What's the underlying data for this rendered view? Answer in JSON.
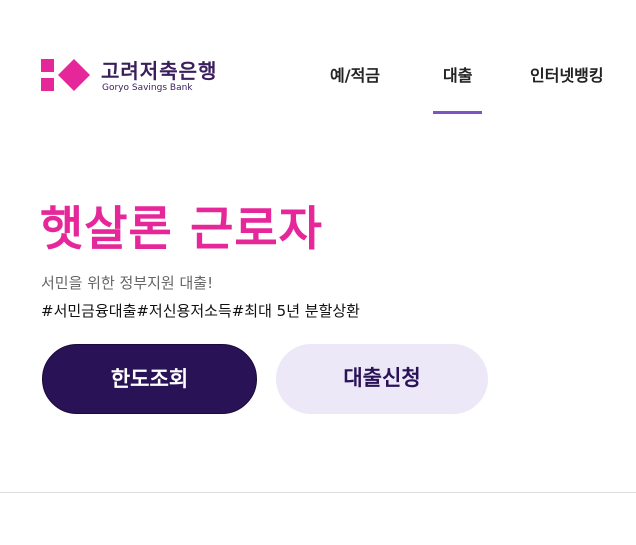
{
  "brand": {
    "name_ko": "고려저축은행",
    "name_en": "Goryo Savings Bank",
    "colors": {
      "primary": "#e6279a",
      "dark": "#2a1257",
      "light": "#ece8f8",
      "accent": "#7b55c7"
    }
  },
  "nav": {
    "items": [
      {
        "label": "예/적금",
        "active": false
      },
      {
        "label": "대출",
        "active": true
      },
      {
        "label": "인터넷뱅킹",
        "active": false
      }
    ]
  },
  "hero": {
    "title": "햇살론 근로자",
    "subtitle": "서민을 위한 정부지원 대출!",
    "tags": "#서민금융대출#저신용저소득#최대 5년 분할상환"
  },
  "actions": {
    "limit_label": "한도조회",
    "apply_label": "대출신청"
  }
}
